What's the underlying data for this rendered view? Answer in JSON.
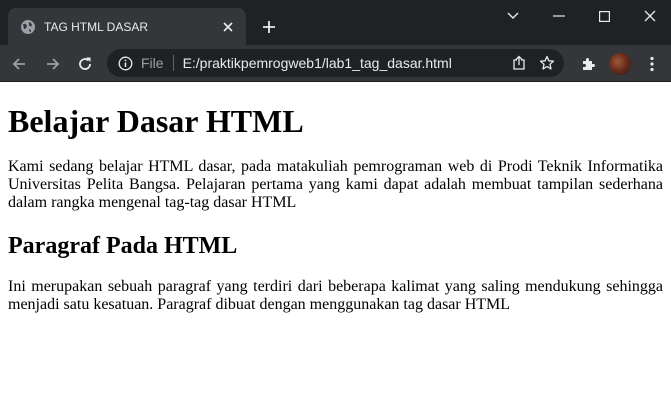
{
  "browser": {
    "tab": {
      "title": "TAG HTML DASAR",
      "favicon": "globe-icon"
    },
    "omnibox": {
      "scheme_label": "File",
      "url": "E:/praktikpemrogweb1/lab1_tag_dasar.html"
    },
    "colors": {
      "frame": "#202124",
      "toolbar": "#35363a",
      "text": "#e8eaed",
      "muted": "#9aa0a6"
    }
  },
  "page": {
    "heading": "Belajar Dasar HTML",
    "paragraph1": "Kami sedang belajar HTML dasar, pada matakuliah pemrograman web di Prodi Teknik Informatika Universitas Pelita Bangsa. Pelajaran pertama yang kami dapat adalah membuat tampilan sederhana dalam rangka mengenal tag-tag dasar HTML",
    "subheading": "Paragraf Pada HTML",
    "paragraph2": "Ini merupakan sebuah paragraf yang terdiri dari beberapa kalimat yang saling mendukung sehingga menjadi satu kesatuan. Paragraf dibuat dengan menggunakan tag dasar HTML"
  }
}
